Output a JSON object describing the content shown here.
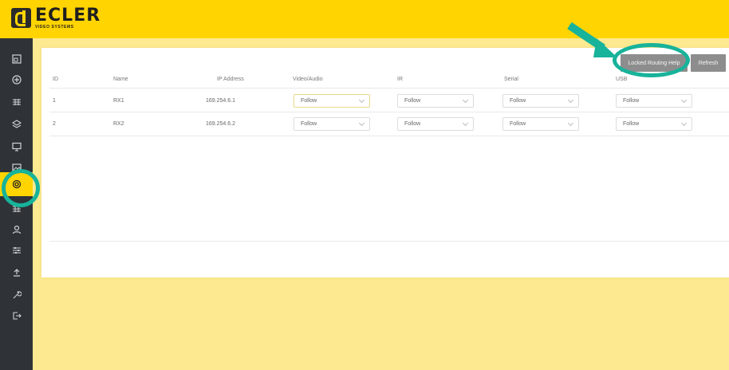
{
  "brand": {
    "word": "ECLER",
    "sub": "VIDEO SYSTEMS"
  },
  "buttons": {
    "help": "Locked Routing Help",
    "refresh": "Refresh"
  },
  "table": {
    "headers": [
      "ID",
      "Name",
      "IP Address",
      "Video/Audio",
      "IR",
      "Serial",
      "USB"
    ],
    "rows": [
      {
        "id": "1",
        "name": "RX1",
        "ip": "169.254.6.1",
        "video_audio": "Follow",
        "ir": "Follow",
        "serial": "Follow",
        "usb": "Follow"
      },
      {
        "id": "2",
        "name": "RX2",
        "ip": "169.254.6.2",
        "video_audio": "Follow",
        "ir": "Follow",
        "serial": "Follow",
        "usb": "Follow"
      }
    ]
  },
  "sidebar": {
    "items": [
      {
        "icon": "dashboard-icon"
      },
      {
        "icon": "add-circle-icon"
      },
      {
        "icon": "grid-icon"
      },
      {
        "icon": "layers-icon"
      },
      {
        "icon": "monitor-icon"
      },
      {
        "icon": "image-icon"
      },
      {
        "icon": "routing-icon",
        "active": true
      },
      {
        "icon": "grid-small-icon"
      },
      {
        "icon": "user-icon"
      },
      {
        "icon": "sliders-icon"
      },
      {
        "icon": "upload-icon"
      },
      {
        "icon": "wrench-icon"
      },
      {
        "icon": "logout-icon"
      }
    ]
  },
  "colors": {
    "accent": "#ffd400",
    "highlight": "#17b39a",
    "sidebar": "#2f3337"
  }
}
